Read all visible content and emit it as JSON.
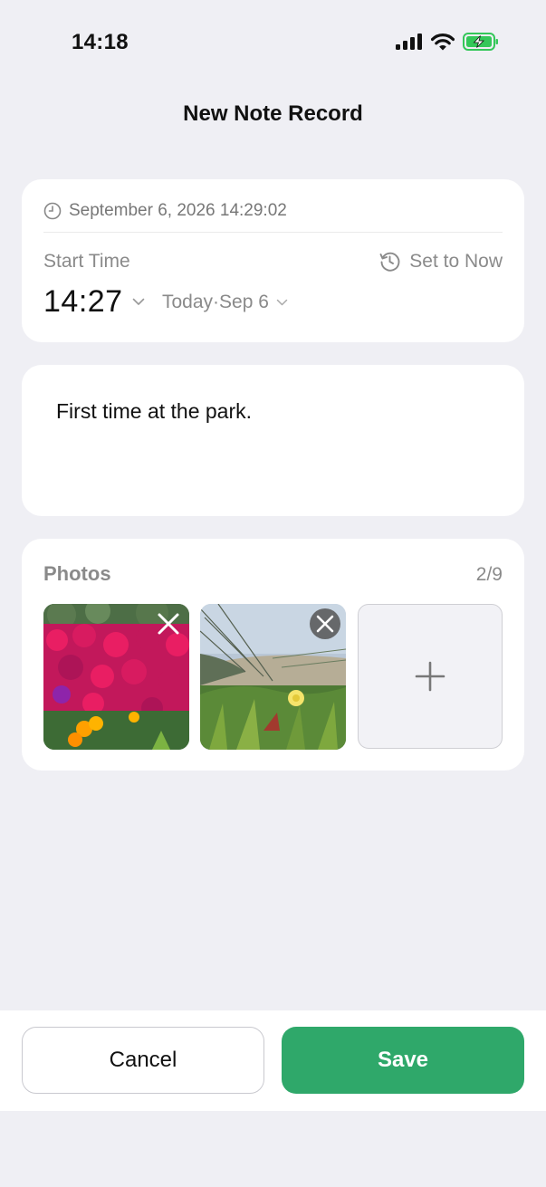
{
  "status_bar": {
    "time": "14:18",
    "icons": [
      "cellular-signal-icon",
      "wifi-icon",
      "battery-charging-icon"
    ],
    "battery_color": "#34c759"
  },
  "header": {
    "title": "New Note Record"
  },
  "time_card": {
    "timestamp": "September 6, 2026 14:29:02",
    "start_label": "Start Time",
    "set_now_label": "Set to Now",
    "start_time": "14:27",
    "start_date": "Today·Sep 6"
  },
  "note": {
    "text": "First time at the park."
  },
  "photos": {
    "title": "Photos",
    "count": "2/9",
    "items": [
      {
        "description_icon": "photo-thumbnail"
      },
      {
        "description_icon": "photo-thumbnail"
      }
    ],
    "add_icon": "plus-icon"
  },
  "actions": {
    "cancel_label": "Cancel",
    "save_label": "Save",
    "save_color": "#2fa86a"
  }
}
